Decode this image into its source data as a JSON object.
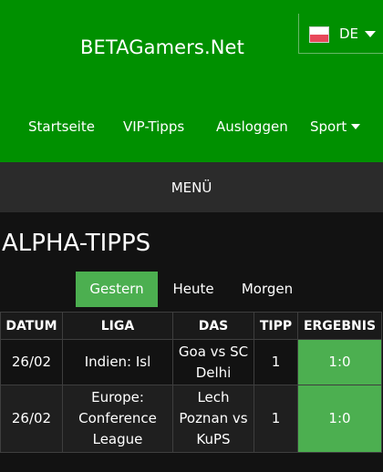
{
  "header": {
    "site_title": "BETAGamers.Net",
    "language": {
      "code": "DE",
      "flag": "flag-icon"
    },
    "nav": {
      "home": "Startseite",
      "vip": "VIP-Tipps",
      "logout": "Ausloggen",
      "sport": "Sport"
    }
  },
  "menu": {
    "label": "MENÜ"
  },
  "page": {
    "title": "ALPHA-TIPPS"
  },
  "tabs": {
    "yesterday": "Gestern",
    "today": "Heute",
    "tomorrow": "Morgen",
    "active": "Gestern"
  },
  "table": {
    "headers": {
      "date": "DATUM",
      "league": "LIGA",
      "match": "DAS",
      "tip": "TIPP",
      "result": "ERGEBNIS"
    },
    "rows": [
      {
        "date": "26/02",
        "league": "Indien: Isl",
        "match": "Goa vs SC Delhi",
        "tip": "1",
        "result": "1:0"
      },
      {
        "date": "26/02",
        "league": "Europe: Conference League",
        "match": "Lech Poznan vs KuPS",
        "tip": "1",
        "result": "1:0"
      }
    ]
  },
  "colors": {
    "header_green": "#009000",
    "accent_green": "#4caf50",
    "menu_bar": "#2b2b2b",
    "background": "#121212"
  }
}
